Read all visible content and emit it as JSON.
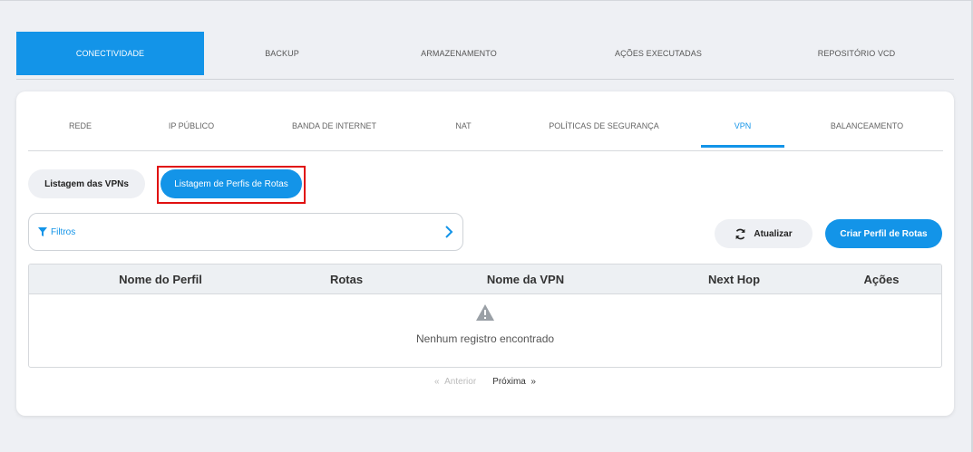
{
  "top_tabs": [
    {
      "label": "CONECTIVIDADE",
      "active": true
    },
    {
      "label": "BACKUP",
      "active": false
    },
    {
      "label": "ARMAZENAMENTO",
      "active": false
    },
    {
      "label": "AÇÕES EXECUTADAS",
      "active": false
    },
    {
      "label": "REPOSITÓRIO VCD",
      "active": false
    }
  ],
  "sub_tabs": [
    {
      "label": "REDE",
      "active": false
    },
    {
      "label": "IP PÚBLICO",
      "active": false
    },
    {
      "label": "BANDA DE INTERNET",
      "active": false
    },
    {
      "label": "NAT",
      "active": false
    },
    {
      "label": "POLÍTICAS DE SEGURANÇA",
      "active": false
    },
    {
      "label": "VPN",
      "active": true
    },
    {
      "label": "BALANCEAMENTO",
      "active": false
    }
  ],
  "view_toggle": {
    "vpn_list": "Listagem das VPNs",
    "route_profiles": "Listagem de Perfis de Rotas"
  },
  "filters": {
    "label": "Filtros"
  },
  "actions": {
    "refresh": "Atualizar",
    "create": "Criar Perfil de Rotas"
  },
  "table": {
    "columns": [
      "Nome do Perfil",
      "Rotas",
      "Nome da VPN",
      "Next Hop",
      "Ações"
    ],
    "empty_message": "Nenhum registro encontrado"
  },
  "pagination": {
    "previous": "Anterior",
    "next": "Próxima"
  },
  "colors": {
    "accent": "#1394e8",
    "highlight": "#e01010",
    "background": "#eef0f4"
  }
}
